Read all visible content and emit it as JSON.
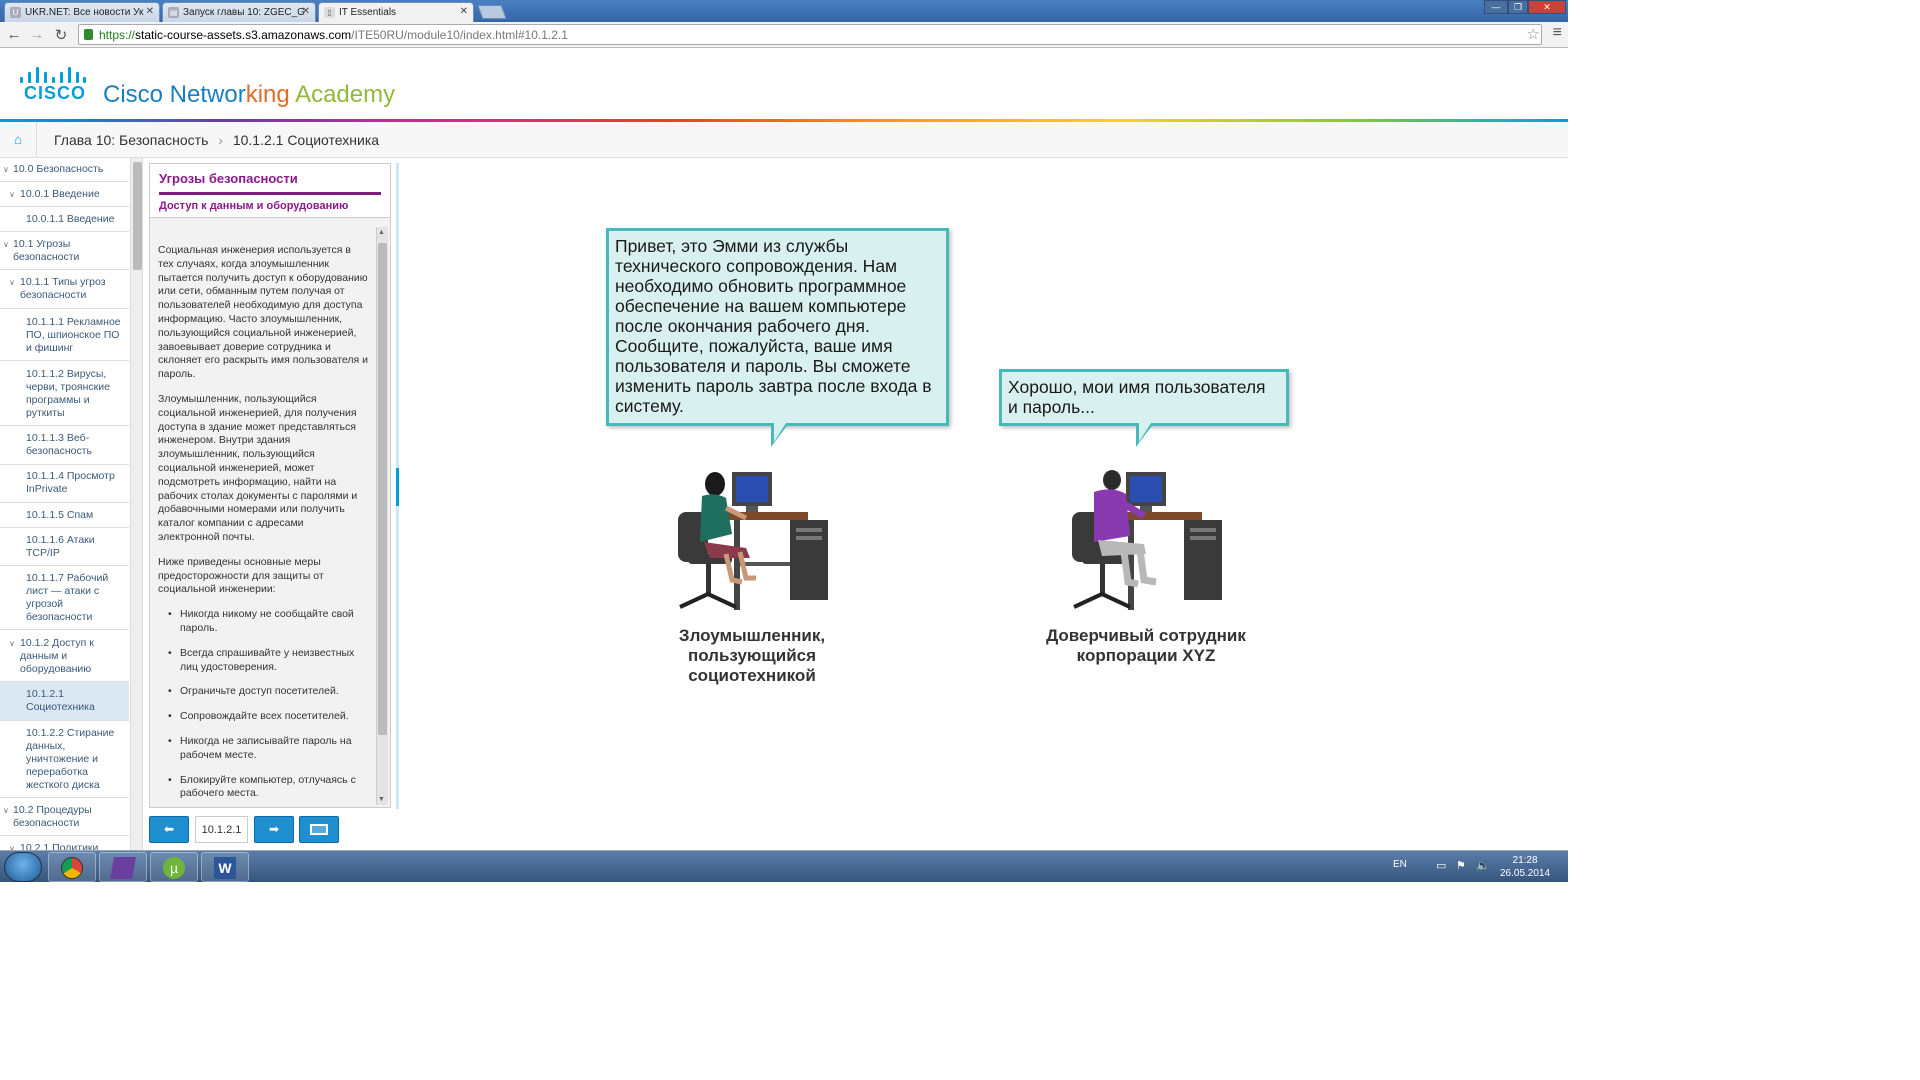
{
  "browser": {
    "tabs": [
      {
        "label": "UKR.NET: Все новости Ук"
      },
      {
        "label": "Запуск главы 10: ZGEC_G"
      },
      {
        "label": "IT Essentials"
      }
    ],
    "url": {
      "scheme": "https://",
      "host": "static-course-assets.s3.amazonaws.com",
      "path": "/ITE50RU/module10/index.html#10.1.2.1"
    }
  },
  "header": {
    "cisco_word": "CISCO",
    "brand_part1": "Cisco Networ",
    "brand_part2": "king ",
    "brand_part3": "Academy"
  },
  "breadcrumb": {
    "chapter": "Глава 10: Безопасность",
    "separator": "›",
    "section": "10.1.2.1 Социотехника"
  },
  "nav": {
    "items": [
      {
        "label": "10.0 Безопасность"
      },
      {
        "label": "10.0.1 Введение"
      },
      {
        "label": "10.0.1.1 Введение"
      },
      {
        "label": "10.1 Угрозы безопасности"
      },
      {
        "label": "10.1.1 Типы угроз безопасности"
      },
      {
        "label": "10.1.1.1 Рекламное ПО, шпионское ПО и фишинг"
      },
      {
        "label": "10.1.1.2 Вирусы, черви, троянские программы и руткиты"
      },
      {
        "label": "10.1.1.3 Веб-безопасность"
      },
      {
        "label": "10.1.1.4 Просмотр InPrivate"
      },
      {
        "label": "10.1.1.5 Спам"
      },
      {
        "label": "10.1.1.6 Атаки TCP/IP"
      },
      {
        "label": "10.1.1.7 Рабочий лист — атаки с угрозой безопасности"
      },
      {
        "label": "10.1.2 Доступ к данным и оборудованию"
      },
      {
        "label": "10.1.2.1 Социотехника"
      },
      {
        "label": "10.1.2.2 Стирание данных, уничтожение и переработка жесткого диска"
      },
      {
        "label": "10.2 Процедуры безопасности"
      },
      {
        "label": "10.2.1 Политики"
      }
    ]
  },
  "panel": {
    "title": "Угрозы безопасности",
    "subtitle": "Доступ к данным и оборудованию",
    "paragraphs": [
      "Социальная инженерия используется в тех случаях, когда злоумышленник пытается получить доступ к оборудованию или сети, обманным путем получая от пользователей необходимую для доступа информацию. Часто злоумышленник, пользующийся социальной инженерией, завоевывает доверие сотрудника и склоняет его раскрыть имя пользователя и пароль.",
      "Злоумышленник, пользующийся социальной инженерией, для получения доступа в здание может представляться инженером. Внутри здания злоумышленник, пользующийся социальной инженерией, может подсмотреть информацию, найти на рабочих столах документы с паролями и добавочными номерами или получить каталог компании с адресами электронной почты.",
      "Ниже приведены основные меры предосторожности для защиты от социальной инженерии:"
    ],
    "bullets": [
      "Никогда никому не сообщайте свой пароль.",
      "Всегда спрашивайте у неизвестных лиц удостоверения.",
      "Ограничьте доступ посетителей.",
      "Сопровождайте всех посетителей.",
      "Никогда не записывайте пароль на рабочем месте.",
      "Блокируйте компьютер, отлучаясь с рабочего места."
    ]
  },
  "controls": {
    "page_number": "10.1.2.1"
  },
  "scene": {
    "bubble_left": "Привет, это Эмми из службы технического сопровождения. Нам необходимо обновить программное обеспечение на вашем компьютере после окончания рабочего дня. Сообщите, пожалуйста, ваше имя пользователя и пароль. Вы сможете изменить пароль завтра после входа в систему.",
    "bubble_right": "Хорошо, мои имя пользователя и пароль...",
    "caption_left": "Злоумышленник, пользующийся социотехникой",
    "caption_right": "Доверчивый сотрудник корпорации XYZ"
  },
  "taskbar": {
    "lang": "EN",
    "time": "21:28",
    "date": "26.05.2014"
  },
  "colors": {
    "cisco_blue": "#049fd9",
    "panel_purple": "#8a1a8a",
    "bubble_fill": "#d8f0f0",
    "bubble_border": "#49b8b8"
  }
}
